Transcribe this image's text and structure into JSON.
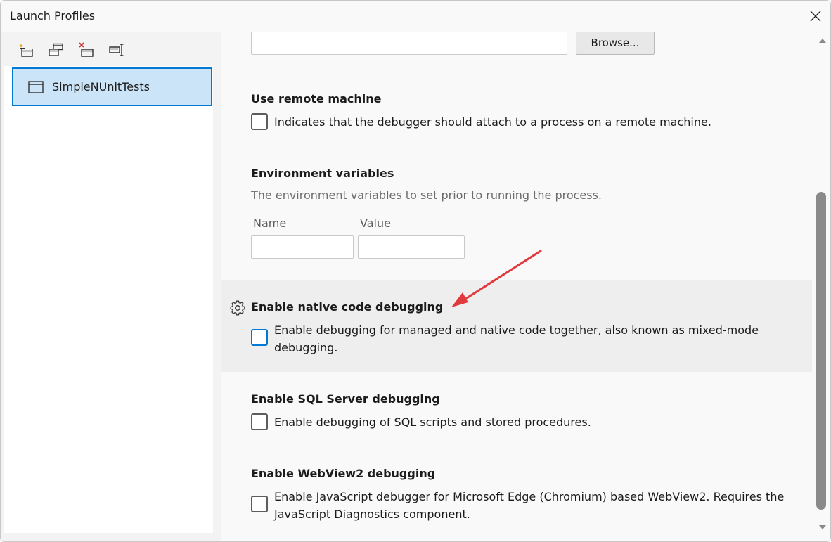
{
  "window": {
    "title": "Launch Profiles"
  },
  "sidebar": {
    "toolbar": [
      {
        "icon": "new-profile-icon"
      },
      {
        "icon": "duplicate-profile-icon"
      },
      {
        "icon": "delete-profile-icon"
      },
      {
        "icon": "rename-profile-icon"
      }
    ],
    "profiles": [
      {
        "label": "SimpleNUnitTests",
        "selected": true
      }
    ]
  },
  "content": {
    "path_input": {
      "value": ""
    },
    "browse_label": "Browse...",
    "remote": {
      "title": "Use remote machine",
      "desc": "Indicates that the debugger should attach to a process on a remote machine.",
      "checked": false
    },
    "env": {
      "title": "Environment variables",
      "desc": "The environment variables to set prior to running the process.",
      "name_label": "Name",
      "value_label": "Value"
    },
    "native": {
      "title": "Enable native code debugging",
      "desc": "Enable debugging for managed and native code together, also known as mixed-mode debugging.",
      "checked": false
    },
    "sql": {
      "title": "Enable SQL Server debugging",
      "desc": "Enable debugging of SQL scripts and stored procedures.",
      "checked": false
    },
    "webview": {
      "title": "Enable WebView2 debugging",
      "desc": "Enable JavaScript debugger for Microsoft Edge (Chromium) based WebView2. Requires the JavaScript Diagnostics component.",
      "checked": false
    }
  },
  "colors": {
    "accent": "#0078d4",
    "selection": "#cce4f7",
    "arrow": "#e0393e"
  }
}
